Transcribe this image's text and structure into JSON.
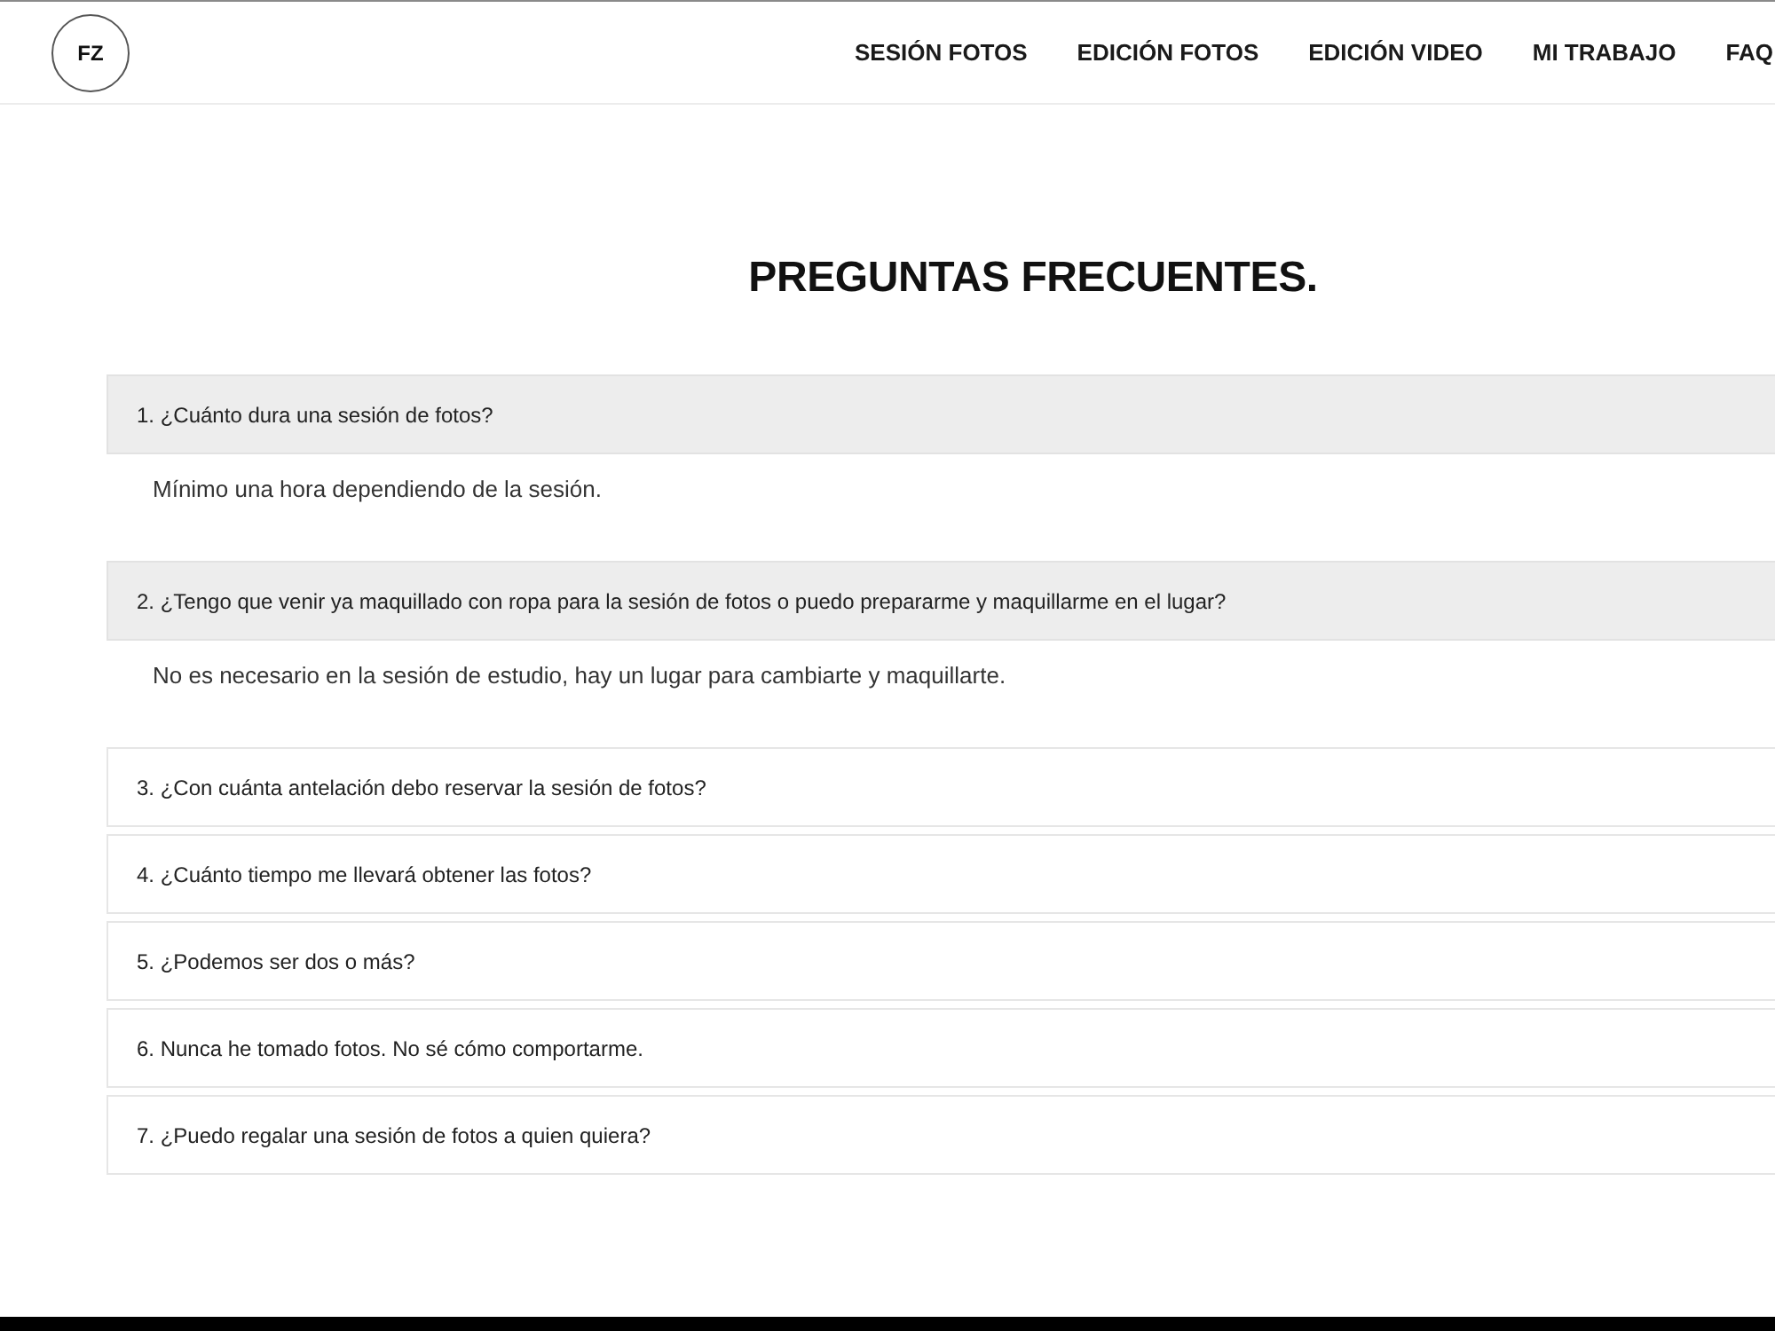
{
  "header": {
    "logo": "FZ",
    "nav": [
      {
        "label": "SESIÓN FOTOS"
      },
      {
        "label": "EDICIÓN FOTOS"
      },
      {
        "label": "EDICIÓN VIDEO"
      },
      {
        "label": "MI TRABAJO"
      },
      {
        "label": "FAQ"
      }
    ]
  },
  "faq": {
    "title": "PREGUNTAS FRECUENTES.",
    "items": [
      {
        "question": "1. ¿Cuánto dura una sesión de fotos?",
        "expanded": true,
        "answer": "Mínimo una hora dependiendo de la sesión."
      },
      {
        "question": "2. ¿Tengo que venir ya maquillado con ropa para la sesión de fotos o puedo prepararme y maquillarme en el lugar?",
        "expanded": true,
        "answer": "No es necesario en la sesión de estudio, hay un lugar para cambiarte y maquillarte."
      },
      {
        "question": "3. ¿Con cuánta antelación debo reservar la sesión de fotos?",
        "expanded": false
      },
      {
        "question": "4. ¿Cuánto tiempo me llevará obtener las fotos?",
        "expanded": false
      },
      {
        "question": "5. ¿Podemos ser dos o más?",
        "expanded": false
      },
      {
        "question": "6. Nunca he tomado fotos. No sé cómo comportarme.",
        "expanded": false
      },
      {
        "question": "7. ¿Puedo regalar una sesión de fotos a quien quiera?",
        "expanded": false
      }
    ]
  }
}
